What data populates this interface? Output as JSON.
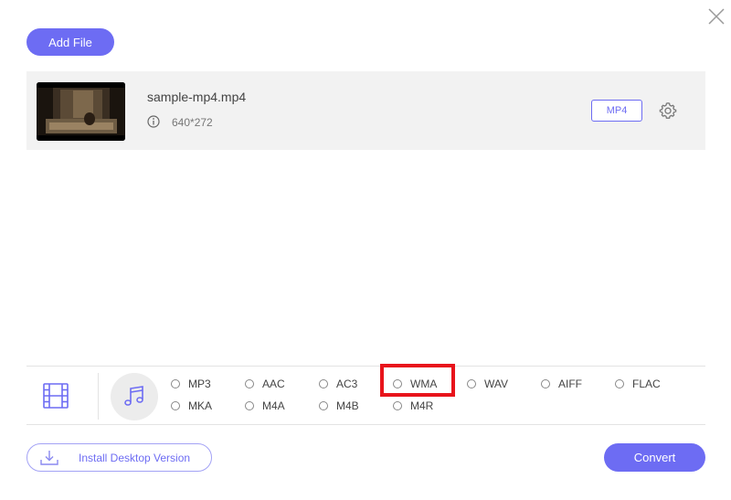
{
  "window": {
    "close_icon": "close-icon"
  },
  "toolbar": {
    "add_file_label": "Add File"
  },
  "file": {
    "name": "sample-mp4.mp4",
    "resolution": "640*272",
    "format": "MP4",
    "info_icon": "info-icon",
    "settings_icon": "gear-icon"
  },
  "format_panel": {
    "video_tab_icon": "film-icon",
    "audio_tab_icon": "music-note-icon",
    "selected": "WMA",
    "row1": [
      "MP3",
      "AAC",
      "AC3",
      "WMA",
      "WAV",
      "AIFF",
      "FLAC"
    ],
    "row2": [
      "MKA",
      "M4A",
      "M4B",
      "M4R"
    ]
  },
  "footer": {
    "install_label": "Install Desktop Version",
    "install_icon": "download-icon",
    "convert_label": "Convert"
  },
  "colors": {
    "accent": "#6d6cf3",
    "highlight": "#e8141b",
    "row_bg": "#f2f2f2"
  }
}
